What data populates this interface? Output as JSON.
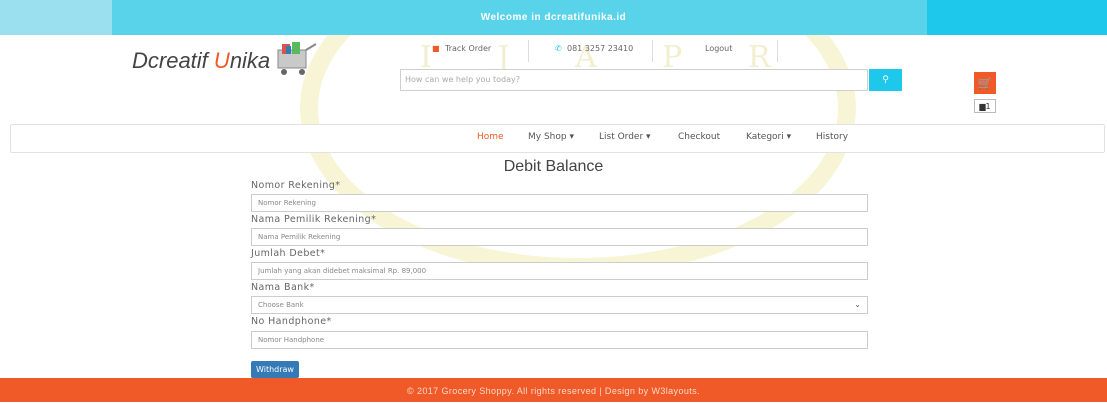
{
  "topbar": {
    "welcome": "Welcome in dcreatifunika.id"
  },
  "header": {
    "logo_main": "Dcreatif ",
    "logo_accent": "U",
    "logo_rest": "nika",
    "track_order": "Track Order",
    "phone": "081 3257 23410",
    "logout": "Logout",
    "search_placeholder": "How can we help you today?",
    "cart_count": "1"
  },
  "nav": {
    "items": [
      {
        "label": "Home",
        "active": true
      },
      {
        "label": "My Shop ▾"
      },
      {
        "label": "List Order ▾"
      },
      {
        "label": "Checkout"
      },
      {
        "label": "Kategori ▾"
      },
      {
        "label": "History"
      }
    ]
  },
  "form": {
    "title": "Debit Balance",
    "fields": [
      {
        "label": "Nomor Rekening*",
        "placeholder": "Nomor Rekening"
      },
      {
        "label": "Nama Pemilik Rekening*",
        "placeholder": "Nama Pemilik Rekening"
      },
      {
        "label": "Jumlah Debet*",
        "placeholder": "Jumlah yang akan didebet maksimal Rp. 89,000"
      },
      {
        "label": "Nama Bank*",
        "placeholder": "Choose Bank"
      },
      {
        "label": "No Handphone*",
        "placeholder": "Nomor Handphone"
      }
    ],
    "submit": "Withdraw"
  },
  "footer": {
    "text": "© 2017 Grocery Shoppy. All rights reserved | Design by W3layouts."
  },
  "colors": {
    "accent": "#f05a28",
    "topbar": "#1ec8ea",
    "button": "#337ab7"
  }
}
